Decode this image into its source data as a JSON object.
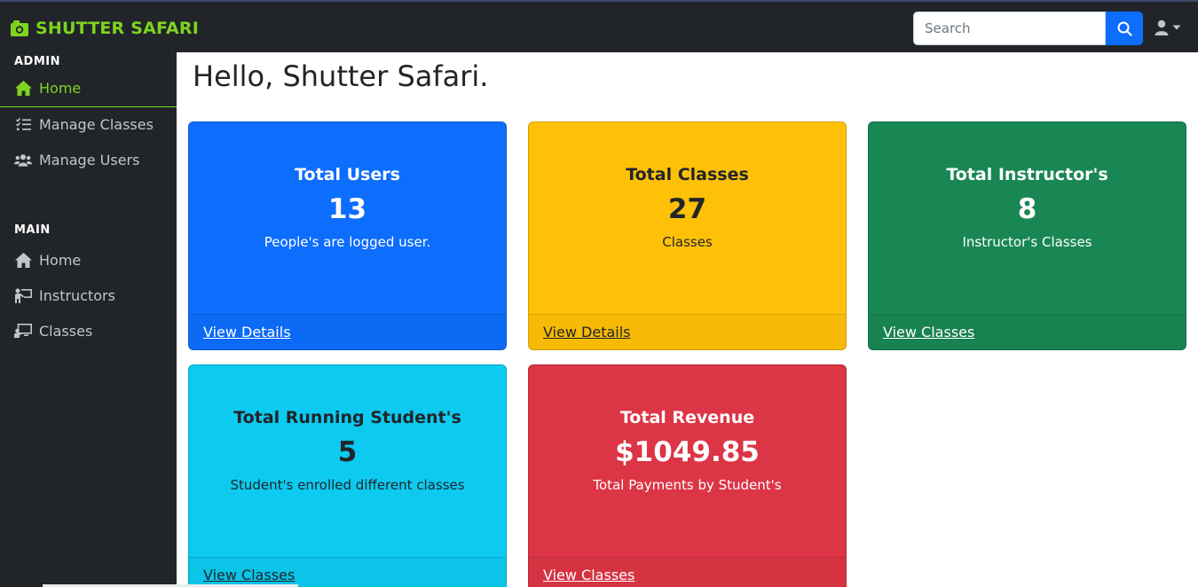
{
  "brand": {
    "name": "SHUTTER SAFARI",
    "icon": "camera-icon",
    "color": "#7fd320"
  },
  "search": {
    "placeholder": "Search",
    "button_icon": "search-icon"
  },
  "user_menu": {
    "icon": "user-icon",
    "caret": "caret-down-icon"
  },
  "sidebar": {
    "admin_heading": "ADMIN",
    "admin_items": [
      {
        "label": "Home",
        "icon": "home-icon",
        "active": true
      },
      {
        "label": "Manage Classes",
        "icon": "list-check-icon"
      },
      {
        "label": "Manage Users",
        "icon": "users-icon"
      }
    ],
    "main_heading": "MAIN",
    "main_items": [
      {
        "label": "Home",
        "icon": "home-icon"
      },
      {
        "label": "Instructors",
        "icon": "instructor-icon"
      },
      {
        "label": "Classes",
        "icon": "classroom-icon"
      }
    ]
  },
  "page": {
    "title": "Hello, Shutter Safari."
  },
  "cards": [
    {
      "title": "Total Users",
      "value": "13",
      "text": "People's are logged user.",
      "link": "View Details",
      "bg": "#0d6efd",
      "fg": "#ffffff"
    },
    {
      "title": "Total Classes",
      "value": "27",
      "text": "Classes",
      "link": "View Details",
      "bg": "#ffc107",
      "fg": "#212529"
    },
    {
      "title": "Total Instructor's",
      "value": "8",
      "text": "Instructor's Classes",
      "link": "View Classes",
      "bg": "#198754",
      "fg": "#ffffff"
    },
    {
      "title": "Total Running Student's",
      "value": "5",
      "text": "Student's enrolled different classes",
      "link": "View Classes",
      "bg": "#0dcaf0",
      "fg": "#212529"
    },
    {
      "title": "Total Revenue",
      "value": "$1049.85",
      "text": "Total Payments by Student's",
      "link": "View Classes",
      "bg": "#dc3545",
      "fg": "#ffffff"
    }
  ]
}
